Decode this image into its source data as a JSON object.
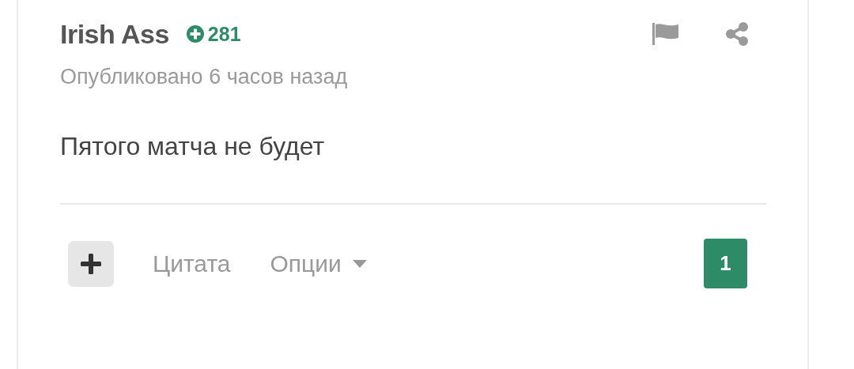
{
  "post": {
    "author": "Irish Ass",
    "reputation": "281",
    "timestamp": "Опубликовано 6 часов назад",
    "body": "Пятого матча не будет"
  },
  "footer": {
    "actions": [
      {
        "label": "Цитата",
        "kind": "link"
      },
      {
        "label": "Опции",
        "kind": "dropdown"
      }
    ],
    "reaction_count": "1"
  }
}
